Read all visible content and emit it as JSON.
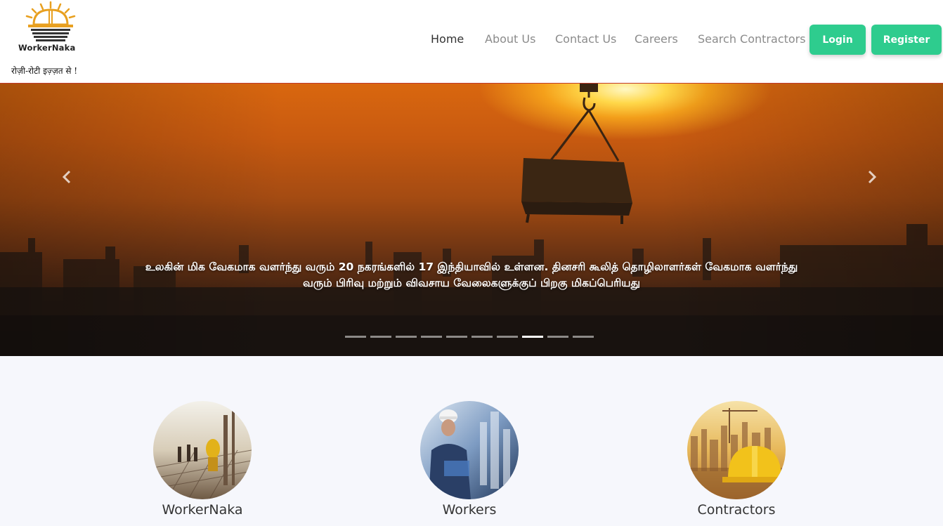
{
  "brand": {
    "name": "WorkerNaka",
    "tagline": "रोज़ी-रोटी इज़्ज़त से !",
    "accent_color": "#2ecc8e"
  },
  "nav": {
    "items": [
      {
        "label": "Home",
        "active": true
      },
      {
        "label": "About Us",
        "active": false
      },
      {
        "label": "Contact Us",
        "active": false
      },
      {
        "label": "Careers",
        "active": false
      },
      {
        "label": "Search Contractors",
        "active": false
      }
    ],
    "login_label": "Login",
    "register_label": "Register"
  },
  "hero": {
    "caption": "உலகின் மிக வேகமாக வளர்ந்து வரும் 20 நகரங்களில் 17 இந்தியாவில் உள்ளன. தினசரி கூலித் தொழிலாளர்கள் வேகமாக வளர்ந்து வரும் பிரிவு மற்றும் விவசாய வேலைகளுக்குப் பிறகு மிகப்பெரியது",
    "prev_icon": "chevron-left-icon",
    "next_icon": "chevron-right-icon",
    "slide_count": 10,
    "active_slide": 8
  },
  "cards": [
    {
      "label": "WorkerNaka",
      "image": "construction-workers-photo"
    },
    {
      "label": "Workers",
      "image": "engineer-city-photo"
    },
    {
      "label": "Contractors",
      "image": "hard-hat-city-photo"
    }
  ]
}
